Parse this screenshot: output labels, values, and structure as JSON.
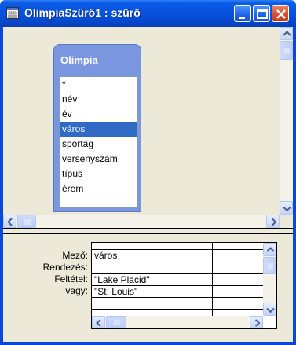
{
  "window": {
    "title": "OlimpiaSzűrő1 : szűrő"
  },
  "table_box": {
    "title": "Olimpia",
    "fields": [
      "*",
      "név",
      "év",
      "város",
      "sportág",
      "versenyszám",
      "típus",
      "érem"
    ],
    "selected_field": "város"
  },
  "grid": {
    "row_labels": [
      "Mező:",
      "Rendezés:",
      "Feltétel:",
      "vagy:"
    ],
    "columns": [
      {
        "field": "város",
        "sort": "",
        "criteria": "\"Lake Placid\"",
        "or": "\"St. Louis\""
      },
      {
        "field": "",
        "sort": "",
        "criteria": "",
        "or": ""
      }
    ]
  },
  "colors": {
    "titlebar": "#0852dd",
    "close_button": "#d8502e",
    "table_header": "#7a96df",
    "selection": "#316ac5",
    "face": "#ece9d8"
  },
  "icons": [
    "query-icon",
    "minimize-icon",
    "maximize-icon",
    "close-icon",
    "scroll-up-icon",
    "scroll-down-icon",
    "scroll-left-icon",
    "scroll-right-icon"
  ]
}
